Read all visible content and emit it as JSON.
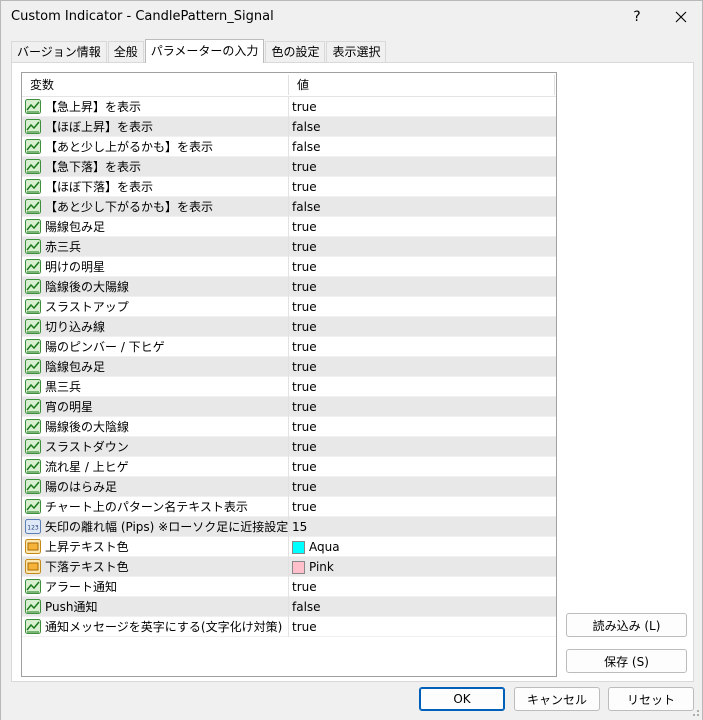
{
  "window": {
    "title": "Custom Indicator - CandlePattern_Signal",
    "help": "?",
    "close": "✕"
  },
  "tabs": [
    {
      "label": "バージョン情報",
      "active": false
    },
    {
      "label": "全般",
      "active": false
    },
    {
      "label": "パラメーターの入力",
      "active": true
    },
    {
      "label": "色の設定",
      "active": false
    },
    {
      "label": "表示選択",
      "active": false
    }
  ],
  "grid": {
    "header_variable": "変数",
    "header_value": "値",
    "rows": [
      {
        "icon": "bool-parameter-icon",
        "name": "【急上昇】を表示",
        "value": "true"
      },
      {
        "icon": "bool-parameter-icon",
        "name": "【ほぼ上昇】を表示",
        "value": "false"
      },
      {
        "icon": "bool-parameter-icon",
        "name": "【あと少し上がるかも】を表示",
        "value": "false"
      },
      {
        "icon": "bool-parameter-icon",
        "name": "【急下落】を表示",
        "value": "true"
      },
      {
        "icon": "bool-parameter-icon",
        "name": "【ほぼ下落】を表示",
        "value": "true"
      },
      {
        "icon": "bool-parameter-icon",
        "name": "【あと少し下がるかも】を表示",
        "value": "false"
      },
      {
        "icon": "bool-parameter-icon",
        "name": "陽線包み足",
        "value": "true"
      },
      {
        "icon": "bool-parameter-icon",
        "name": "赤三兵",
        "value": "true"
      },
      {
        "icon": "bool-parameter-icon",
        "name": "明けの明星",
        "value": "true"
      },
      {
        "icon": "bool-parameter-icon",
        "name": "陰線後の大陽線",
        "value": "true"
      },
      {
        "icon": "bool-parameter-icon",
        "name": "スラストアップ",
        "value": "true"
      },
      {
        "icon": "bool-parameter-icon",
        "name": "切り込み線",
        "value": "true"
      },
      {
        "icon": "bool-parameter-icon",
        "name": "陽のピンバー / 下ヒゲ",
        "value": "true"
      },
      {
        "icon": "bool-parameter-icon",
        "name": "陰線包み足",
        "value": "true"
      },
      {
        "icon": "bool-parameter-icon",
        "name": "黒三兵",
        "value": "true"
      },
      {
        "icon": "bool-parameter-icon",
        "name": "宵の明星",
        "value": "true"
      },
      {
        "icon": "bool-parameter-icon",
        "name": "陽線後の大陰線",
        "value": "true"
      },
      {
        "icon": "bool-parameter-icon",
        "name": "スラストダウン",
        "value": "true"
      },
      {
        "icon": "bool-parameter-icon",
        "name": "流れ星 / 上ヒゲ",
        "value": "true"
      },
      {
        "icon": "bool-parameter-icon",
        "name": "陽のはらみ足",
        "value": "true"
      },
      {
        "icon": "bool-parameter-icon",
        "name": "チャート上のパターン名テキスト表示",
        "value": "true"
      },
      {
        "icon": "integer-parameter-icon",
        "name": "矢印の離れ幅 (Pips) ※ローソク足に近接設定",
        "value": "15"
      },
      {
        "icon": "color-parameter-icon",
        "name": "上昇テキスト色",
        "value": "Aqua",
        "swatch": "#00ffff"
      },
      {
        "icon": "color-parameter-icon",
        "name": "下落テキスト色",
        "value": "Pink",
        "swatch": "#ffc0cb"
      },
      {
        "icon": "bool-parameter-icon",
        "name": "アラート通知",
        "value": "true"
      },
      {
        "icon": "bool-parameter-icon",
        "name": "Push通知",
        "value": "false"
      },
      {
        "icon": "bool-parameter-icon",
        "name": "通知メッセージを英字にする(文字化け対策)",
        "value": "true"
      }
    ]
  },
  "side_buttons": {
    "load": "読み込み (L)",
    "save": "保存 (S)"
  },
  "footer_buttons": {
    "ok": "OK",
    "cancel": "キャンセル",
    "reset": "リセット"
  },
  "colors": {
    "primary_border": "#005fb8",
    "row_alt": "#e8e8e8"
  }
}
